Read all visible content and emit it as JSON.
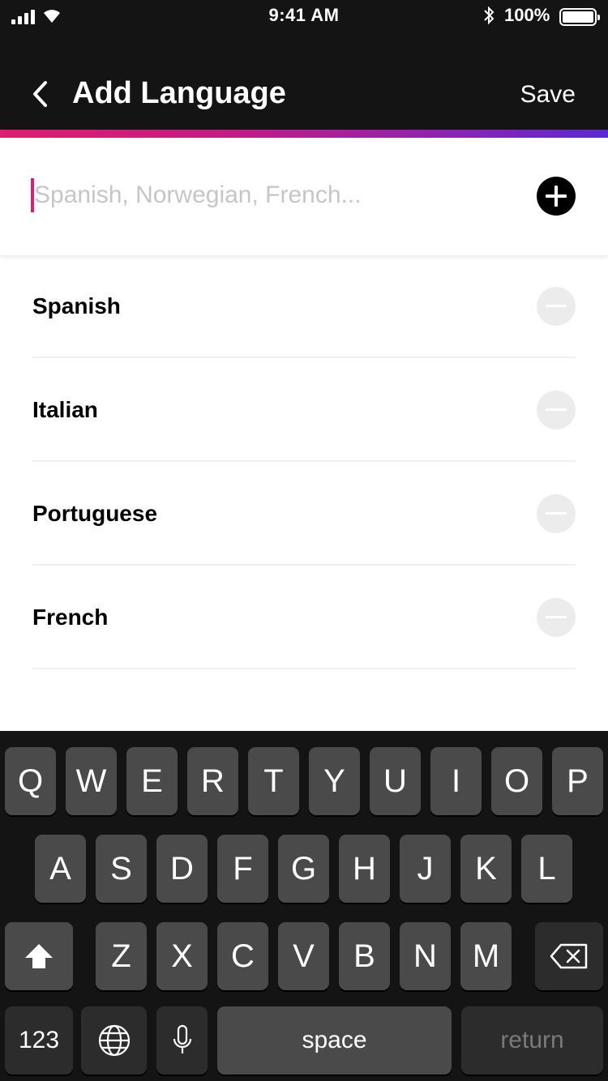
{
  "status_bar": {
    "time": "9:41 AM",
    "battery_percent": "100%"
  },
  "header": {
    "title": "Add Language",
    "save_label": "Save"
  },
  "accent_gradient": [
    "#e01d6e",
    "#5a2ad2"
  ],
  "search": {
    "value": "",
    "placeholder": "Spanish, Norwegian, French..."
  },
  "languages": [
    {
      "label": "Spanish"
    },
    {
      "label": "Italian"
    },
    {
      "label": "Portuguese"
    },
    {
      "label": "French"
    }
  ],
  "keyboard": {
    "row1": [
      "Q",
      "W",
      "E",
      "R",
      "T",
      "Y",
      "U",
      "I",
      "O",
      "P"
    ],
    "row2": [
      "A",
      "S",
      "D",
      "F",
      "G",
      "H",
      "J",
      "K",
      "L"
    ],
    "row3": [
      "Z",
      "X",
      "C",
      "V",
      "B",
      "N",
      "M"
    ],
    "numbers_label": "123",
    "space_label": "space",
    "return_label": "return"
  }
}
